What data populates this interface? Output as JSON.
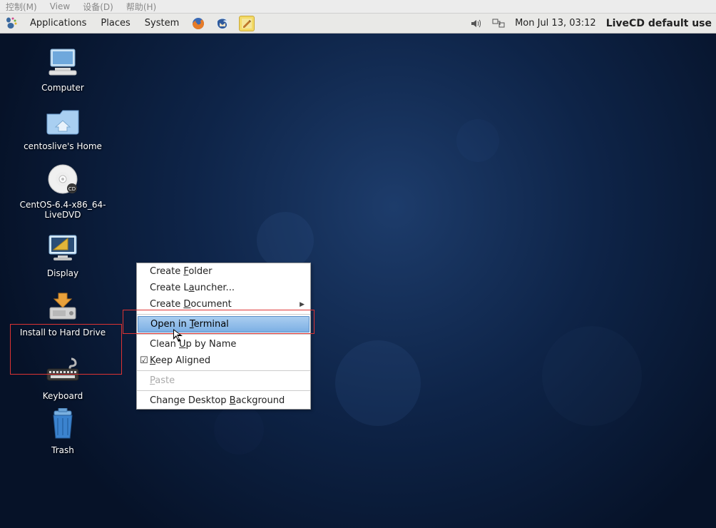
{
  "host_menu": {
    "items": [
      "控制(M)",
      "View",
      "设备(D)",
      "帮助(H)"
    ]
  },
  "panel": {
    "menus": [
      "Applications",
      "Places",
      "System"
    ],
    "clock": "Mon Jul 13, 03:12",
    "user": "LiveCD default use"
  },
  "desktop_icons": [
    {
      "name": "Computer"
    },
    {
      "name": "centoslive's Home"
    },
    {
      "name": "CentOS-6.4-x86_64-LiveDVD"
    },
    {
      "name": "Display"
    },
    {
      "name": "Install to Hard Drive"
    },
    {
      "name": "Keyboard"
    },
    {
      "name": "Trash"
    }
  ],
  "context_menu": {
    "create_folder_pre": "Create ",
    "create_folder_u": "F",
    "create_folder_post": "older",
    "create_launcher_pre": "Create L",
    "create_launcher_u": "a",
    "create_launcher_post": "uncher...",
    "create_document_pre": "Create ",
    "create_document_u": "D",
    "create_document_post": "ocument",
    "open_terminal_pre": "Open in ",
    "open_terminal_u": "T",
    "open_terminal_post": "erminal",
    "clean_up_pre": "Clean ",
    "clean_up_u": "U",
    "clean_up_post": "p by Name",
    "keep_aligned_u": "K",
    "keep_aligned_post": "eep Aligned",
    "paste_u": "P",
    "paste_post": "aste",
    "change_bg_pre": "Change Desktop ",
    "change_bg_u": "B",
    "change_bg_post": "ackground"
  }
}
